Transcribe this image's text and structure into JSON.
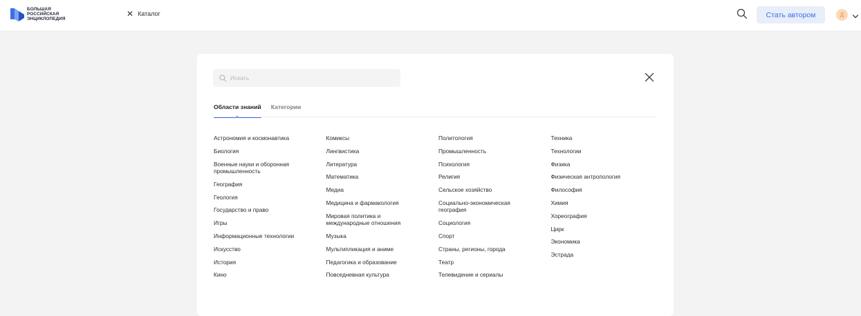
{
  "header": {
    "logo_lines": [
      "БОЛЬШАЯ",
      "РОССИЙСКАЯ",
      "ЭНЦИКЛОПЕДИЯ"
    ],
    "catalog_label": "Каталог",
    "author_button": "Стать автором",
    "avatar_initial": "Д",
    "accent_color": "#3b6ee6"
  },
  "catalog": {
    "search_placeholder": "Искать",
    "tabs": [
      {
        "label": "Области знаний",
        "active": true
      },
      {
        "label": "Категории",
        "active": false
      }
    ],
    "columns": [
      [
        "Астрономия и космонавтика",
        "Биология",
        "Военные науки и оборонная промышленность",
        "География",
        "Геология",
        "Государство и право",
        "Игры",
        "Информационные технологии",
        "Искусство",
        "История",
        "Кино"
      ],
      [
        "Комиксы",
        "Лингвистика",
        "Литература",
        "Математика",
        "Медиа",
        "Медицина и фармакология",
        "Мировая политика и международные отношения",
        "Музыка",
        "Мультипликация и аниме",
        "Педагогика и образование",
        "Повседневная культура"
      ],
      [
        "Политология",
        "Промышленность",
        "Психология",
        "Религия",
        "Сельское хозяйство",
        "Социально-экономическая география",
        "Социология",
        "Спорт",
        "Страны, регионы, города",
        "Театр",
        "Телевидение и сериалы"
      ],
      [
        "Техника",
        "Технологии",
        "Физика",
        "Физическая антропология",
        "Философия",
        "Химия",
        "Хореография",
        "Цирк",
        "Экономика",
        "Эстрада"
      ]
    ]
  }
}
